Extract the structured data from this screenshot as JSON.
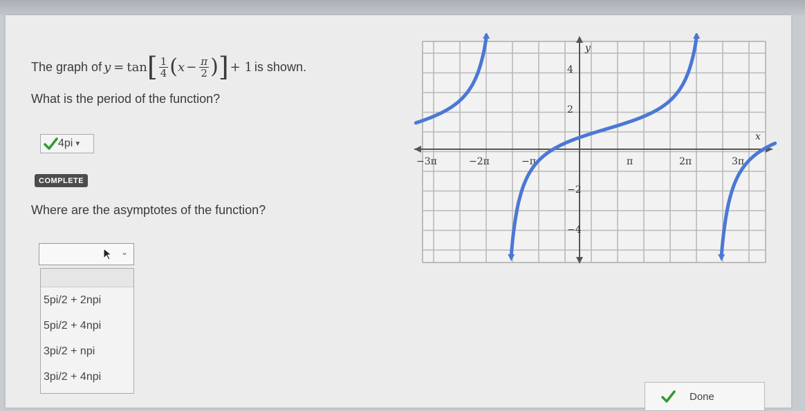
{
  "question1": {
    "prefix": "The graph of",
    "eq_y": "y",
    "eq_equals": "=",
    "eq_func": "tan",
    "eq_frac_num": "1",
    "eq_frac_den": "4",
    "eq_x": "x",
    "eq_minus": "−",
    "eq_pi": "π",
    "eq_two": "2",
    "eq_plus_one": "+ 1",
    "suffix": "is shown."
  },
  "question2": {
    "text": "What is the period of the function?",
    "answer": "4pi"
  },
  "status_badge": "COMPLETE",
  "question3": {
    "text": "Where are the asymptotes of the function?",
    "options": [
      "5pi/2 + 2npi",
      "5pi/2 + 4npi",
      "3pi/2 + npi",
      "3pi/2 + 4npi"
    ]
  },
  "done_label": "Done",
  "graph": {
    "x_axis_label": "x",
    "y_axis_label": "y",
    "x_ticks": [
      {
        "value": -3.14159,
        "label": "−π"
      },
      {
        "value": 3.14159,
        "label": "π"
      },
      {
        "value": 6.28319,
        "label": "2π"
      },
      {
        "value": 9.42478,
        "label": "3π"
      },
      {
        "value": -9.42478,
        "label": "−3π"
      },
      {
        "value": -6.28319,
        "label": "−2π"
      }
    ],
    "y_ticks": [
      {
        "value": 4,
        "label": "4"
      },
      {
        "value": 2,
        "label": "2"
      },
      {
        "value": -2,
        "label": "−2"
      },
      {
        "value": -4,
        "label": "−4"
      }
    ]
  },
  "colors": {
    "curve": "#4a78d4",
    "check": "#2e9b2e",
    "badge_bg": "#4c4c4c"
  }
}
